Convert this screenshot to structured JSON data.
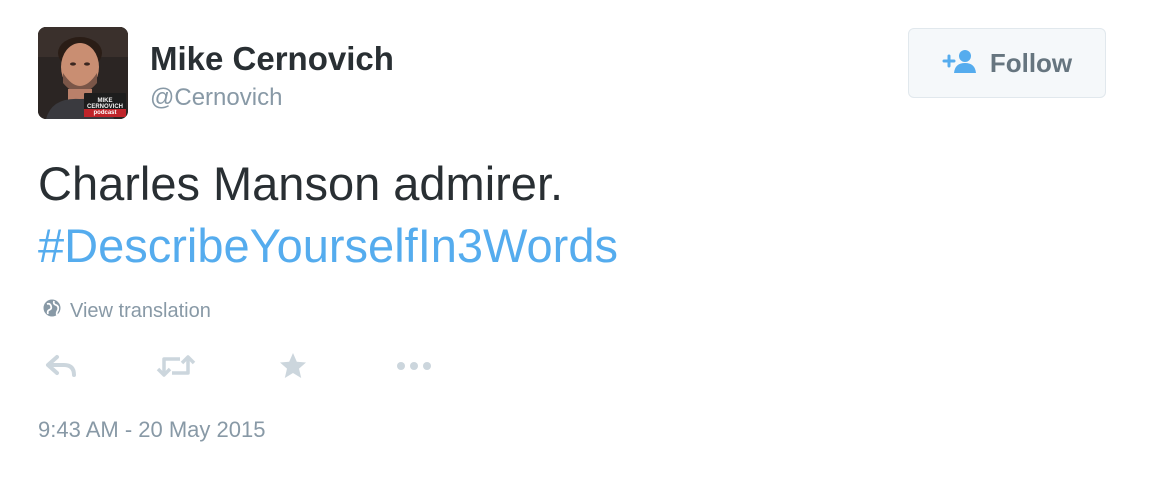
{
  "user": {
    "display_name": "Mike Cernovich",
    "handle": "@Cernovich",
    "avatar_caption_line1": "MIKE",
    "avatar_caption_line2": "CERNOVICH",
    "avatar_caption_line3": "podcast"
  },
  "follow_button": {
    "label": "Follow",
    "icon": "add-user-icon"
  },
  "tweet": {
    "text": "Charles Manson admirer.",
    "hashtag": "#DescribeYourselfIn3Words"
  },
  "translation": {
    "icon": "globe-icon",
    "label": "View translation"
  },
  "actions": [
    {
      "name": "reply",
      "icon": "reply-icon"
    },
    {
      "name": "retweet",
      "icon": "retweet-icon"
    },
    {
      "name": "favorite",
      "icon": "star-icon"
    },
    {
      "name": "more",
      "icon": "more-icon"
    }
  ],
  "timestamp": "9:43 AM - 20 May 2015",
  "colors": {
    "text": "#292f33",
    "muted": "#8899a6",
    "link": "#55acee",
    "button_bg": "#f5f8fa",
    "icon_action": "#ccd6dd"
  }
}
